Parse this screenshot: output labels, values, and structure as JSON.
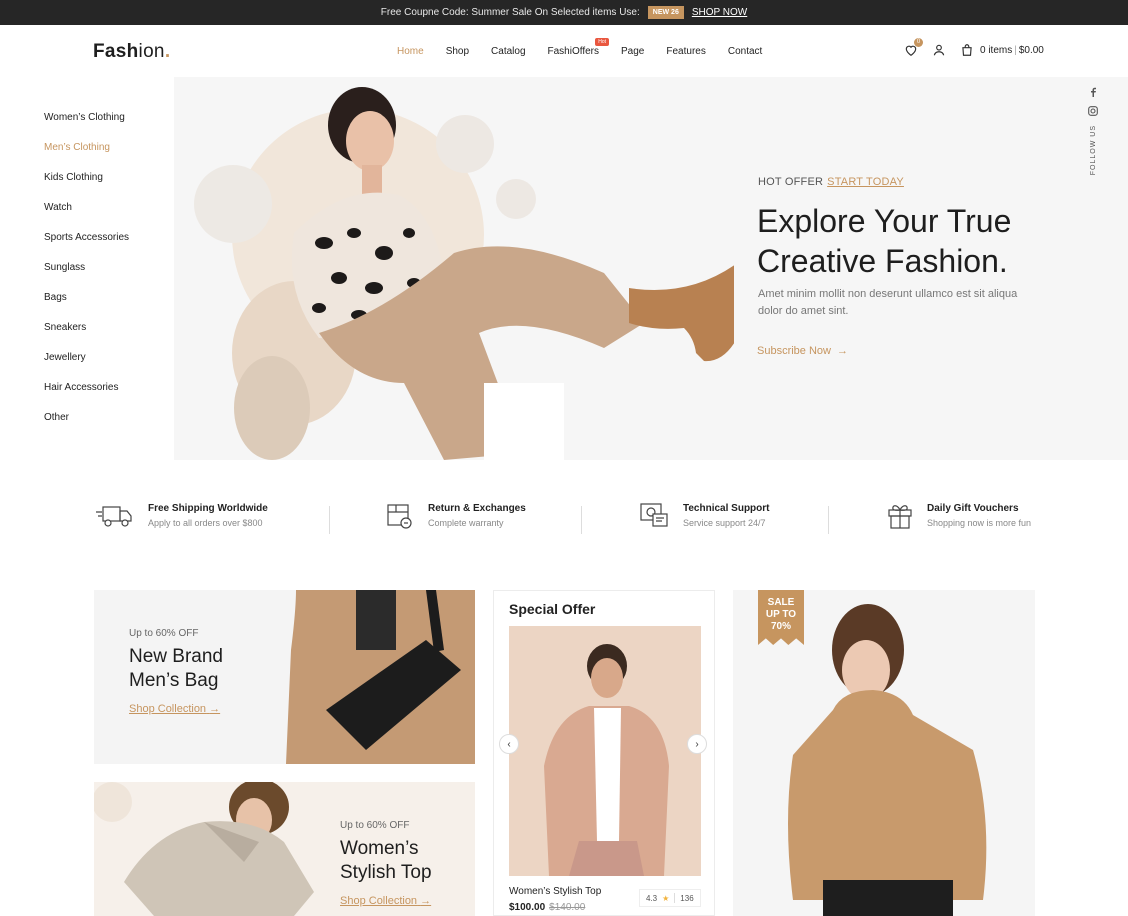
{
  "topbar": {
    "text": "Free Coupne Code: Summer Sale On Selected items Use:",
    "code": "NEW 26",
    "shop_now": "SHOP NOW"
  },
  "header": {
    "logo_bold": "Fash",
    "logo_light": "ion",
    "logo_dot": ".",
    "nav": [
      "Home",
      "Shop",
      "Catalog",
      "FashiOffers",
      "Page",
      "Features",
      "Contact"
    ],
    "hot_badge": "Hot",
    "wishlist_count": "0",
    "cart_items": "0 items",
    "cart_total": "$0.00"
  },
  "categories": [
    "Women’s Clothing",
    "Men’s Clothing",
    "Kids Clothing",
    "Watch",
    "Sports Accessories",
    "Sunglass",
    "Bags",
    "Sneakers",
    "Jewellery",
    "Hair Accessories",
    "Other"
  ],
  "hero": {
    "kicker": "HOT OFFER",
    "kicker_link": "START TODAY",
    "title_line1": "Explore Your True",
    "title_line2": "Creative Fashion.",
    "description": "Amet minim mollit non deserunt ullamco est sit aliqua dolor do amet sint.",
    "cta": "Subscribe Now",
    "follow_us": "FOLLOW US"
  },
  "features": [
    {
      "title": "Free Shipping Worldwide",
      "subtitle": "Apply to all orders over $800"
    },
    {
      "title": "Return & Exchanges",
      "subtitle": "Complete warranty"
    },
    {
      "title": "Technical Support",
      "subtitle": "Service support 24/7"
    },
    {
      "title": "Daily Gift Vouchers",
      "subtitle": "Shopping now is more fun"
    }
  ],
  "promo1": {
    "kicker": "Up to 60% OFF",
    "title_line1": "New Brand",
    "title_line2": "Men’s Bag",
    "link": "Shop Collection"
  },
  "promo2": {
    "kicker": "Up to 60% OFF",
    "title_line1": "Women’s",
    "title_line2": "Stylish Top",
    "link": "Shop Collection"
  },
  "special_offer": {
    "heading": "Special Offer",
    "product_name": "Women’s Stylish Top",
    "price": "$100.00",
    "old_price": "$140.00",
    "rating": "4.3",
    "reviews": "136"
  },
  "sale_tag": {
    "line1": "SALE",
    "line2": "UP TO",
    "line3": "70%"
  },
  "colors": {
    "accent": "#c6955f",
    "topbar": "#262626"
  }
}
